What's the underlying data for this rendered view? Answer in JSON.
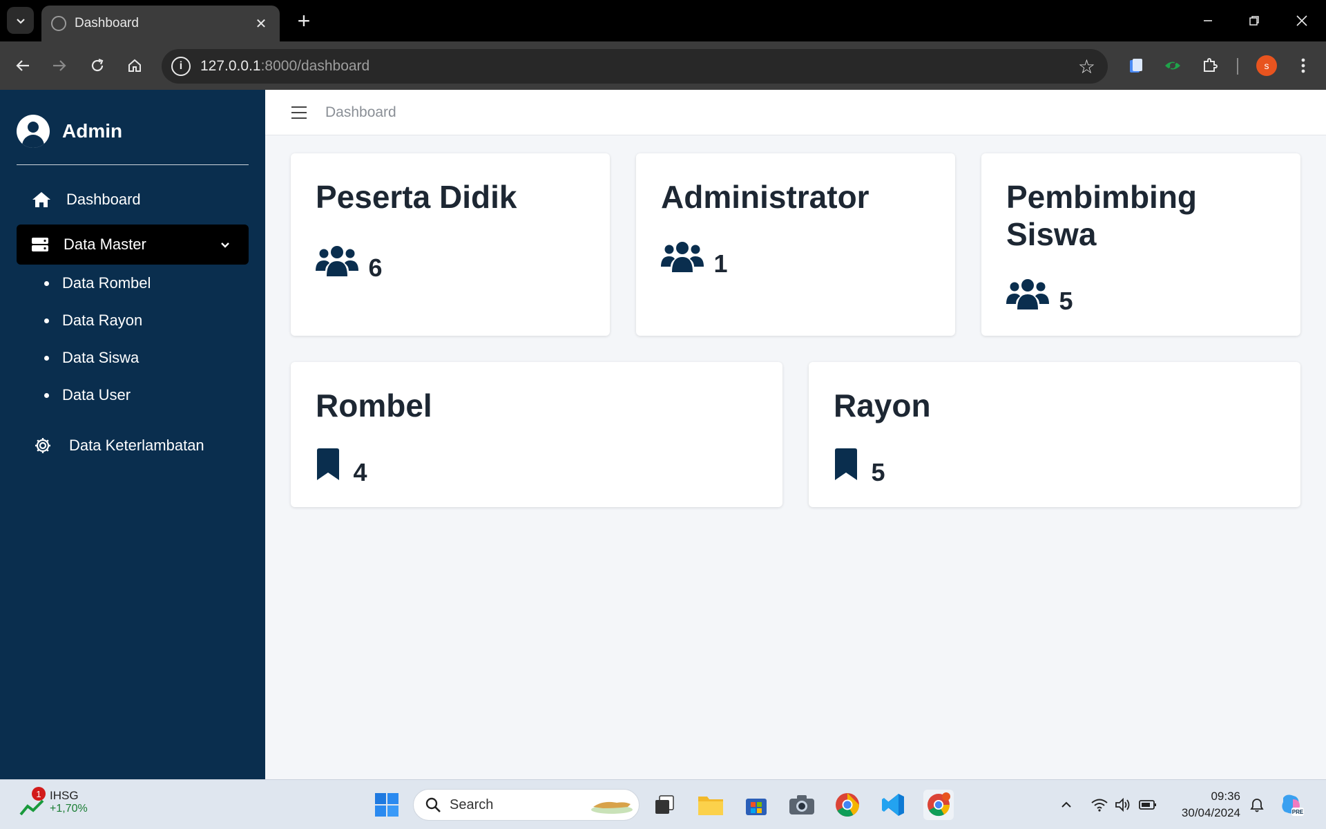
{
  "browser": {
    "tab_title": "Dashboard",
    "url_host": "127.0.0.1",
    "url_path": ":8000/dashboard",
    "profile_initial": "s"
  },
  "sidebar": {
    "brand": "Admin",
    "items": [
      {
        "label": "Dashboard",
        "icon": "home-icon"
      },
      {
        "label": "Data Master",
        "icon": "server-icon",
        "expanded": true
      },
      {
        "label": "Data Keterlambatan",
        "icon": "gear-icon"
      }
    ],
    "sub_items": [
      {
        "label": "Data Rombel"
      },
      {
        "label": "Data Rayon"
      },
      {
        "label": "Data Siswa"
      },
      {
        "label": "Data User"
      }
    ]
  },
  "topbar": {
    "breadcrumb": "Dashboard"
  },
  "cards": [
    {
      "title": "Peserta Didik",
      "value": "6",
      "icon": "users-icon"
    },
    {
      "title": "Administrator",
      "value": "1",
      "icon": "users-icon"
    },
    {
      "title": "Pembimbing Siswa",
      "value": "5",
      "icon": "users-icon"
    },
    {
      "title": "Rombel",
      "value": "4",
      "icon": "bookmark-icon"
    },
    {
      "title": "Rayon",
      "value": "5",
      "icon": "bookmark-icon"
    }
  ],
  "taskbar": {
    "widget_badge": "1",
    "widget_name": "IHSG",
    "widget_change": "+1,70%",
    "search_label": "Search",
    "time": "09:36",
    "date": "30/04/2024"
  },
  "colors": {
    "sidebar_bg": "#0a2e4e",
    "active_item_bg": "#000000",
    "icon_color": "#0a2e4e",
    "content_bg": "#f4f6f9"
  }
}
